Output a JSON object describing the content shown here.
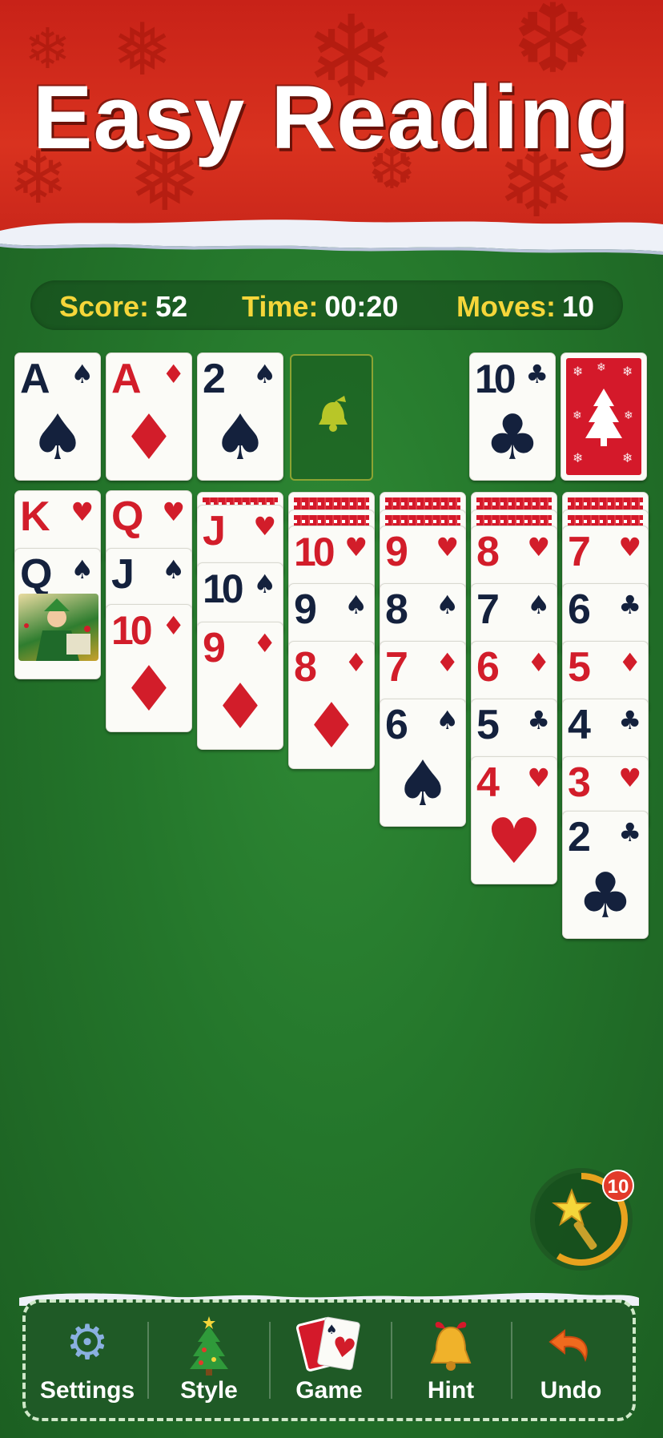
{
  "banner": {
    "title": "Easy Reading"
  },
  "scorebar": {
    "score_label": "Score:",
    "score_value": "52",
    "time_label": "Time:",
    "time_value": "00:20",
    "moves_label": "Moves:",
    "moves_value": "10"
  },
  "foundations": [
    {
      "rank": "A",
      "suit": "♠",
      "color": "black"
    },
    {
      "rank": "A",
      "suit": "♦",
      "color": "red"
    },
    {
      "rank": "2",
      "suit": "♠",
      "color": "black"
    }
  ],
  "waste": {
    "rank": "10",
    "suit": "♣",
    "color": "black"
  },
  "tableau": {
    "col1": [
      {
        "rank": "K",
        "suit": "♥"
      },
      {
        "rank": "Q",
        "suit": "♠"
      }
    ],
    "col2": [
      {
        "rank": "Q",
        "suit": "♥"
      },
      {
        "rank": "J",
        "suit": "♠"
      },
      {
        "rank": "10",
        "suit": "♦"
      }
    ],
    "col3": [
      {
        "rank": "J",
        "suit": "♥"
      },
      {
        "rank": "10",
        "suit": "♠"
      },
      {
        "rank": "9",
        "suit": "♦"
      }
    ],
    "col4": [
      {
        "rank": "10",
        "suit": "♥"
      },
      {
        "rank": "9",
        "suit": "♠"
      },
      {
        "rank": "8",
        "suit": "♦"
      }
    ],
    "col5": [
      {
        "rank": "9",
        "suit": "♥"
      },
      {
        "rank": "8",
        "suit": "♠"
      },
      {
        "rank": "7",
        "suit": "♦"
      },
      {
        "rank": "6",
        "suit": "♠"
      }
    ],
    "col6": [
      {
        "rank": "8",
        "suit": "♥"
      },
      {
        "rank": "7",
        "suit": "♠"
      },
      {
        "rank": "6",
        "suit": "♦"
      },
      {
        "rank": "5",
        "suit": "♣"
      },
      {
        "rank": "4",
        "suit": "♥"
      }
    ],
    "col7": [
      {
        "rank": "7",
        "suit": "♥"
      },
      {
        "rank": "6",
        "suit": "♣"
      },
      {
        "rank": "5",
        "suit": "♦"
      },
      {
        "rank": "4",
        "suit": "♣"
      },
      {
        "rank": "3",
        "suit": "♥"
      },
      {
        "rank": "2",
        "suit": "♣"
      }
    ]
  },
  "hint_wand": {
    "badge_count": "10",
    "icon": "magic-wand-icon"
  },
  "toolbar": {
    "settings_label": "Settings",
    "style_label": "Style",
    "game_label": "Game",
    "hint_label": "Hint",
    "undo_label": "Undo"
  },
  "colors": {
    "felt": "#24762b",
    "banner_red": "#d9321f",
    "card_red": "#d21d2a",
    "card_black": "#14213d",
    "label_yellow": "#f5d63a"
  }
}
